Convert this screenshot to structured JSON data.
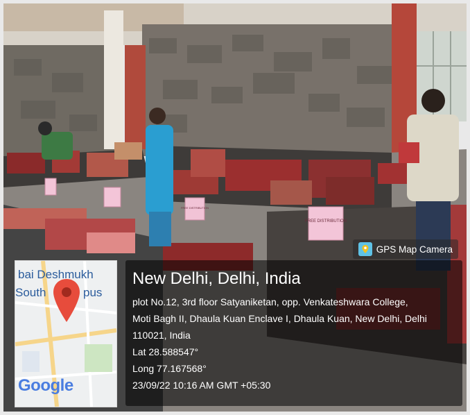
{
  "scene": {
    "description_tags": [
      "book-tables",
      "stone-wall",
      "free-distribution-signs",
      "people-browsing"
    ],
    "signs": [
      "FREE DISTRIBUTION",
      "FREE DISTRIBUTION"
    ]
  },
  "badge": {
    "label": "GPS Map Camera",
    "icon": "map-camera-icon"
  },
  "map": {
    "text_top1": "bai Deshmukh",
    "text_top2": "South",
    "text_top3": "pus",
    "logo": "Google"
  },
  "info": {
    "city": "New Delhi, Delhi, India",
    "address_1": "plot No.12, 3rd floor Satyaniketan, opp. Venkateshwara College,",
    "address_2": "Moti Bagh II, Dhaula Kuan Enclave I, Dhaula Kuan, New Delhi, Delhi",
    "address_3": "110021, India",
    "lat": "Lat 28.588547°",
    "long": "Long 77.167568°",
    "datetime": "23/09/22 10:16 AM GMT +05:30"
  },
  "colors": {
    "pin": "#e74c3c",
    "badge_icon": "#5fc2e6"
  }
}
